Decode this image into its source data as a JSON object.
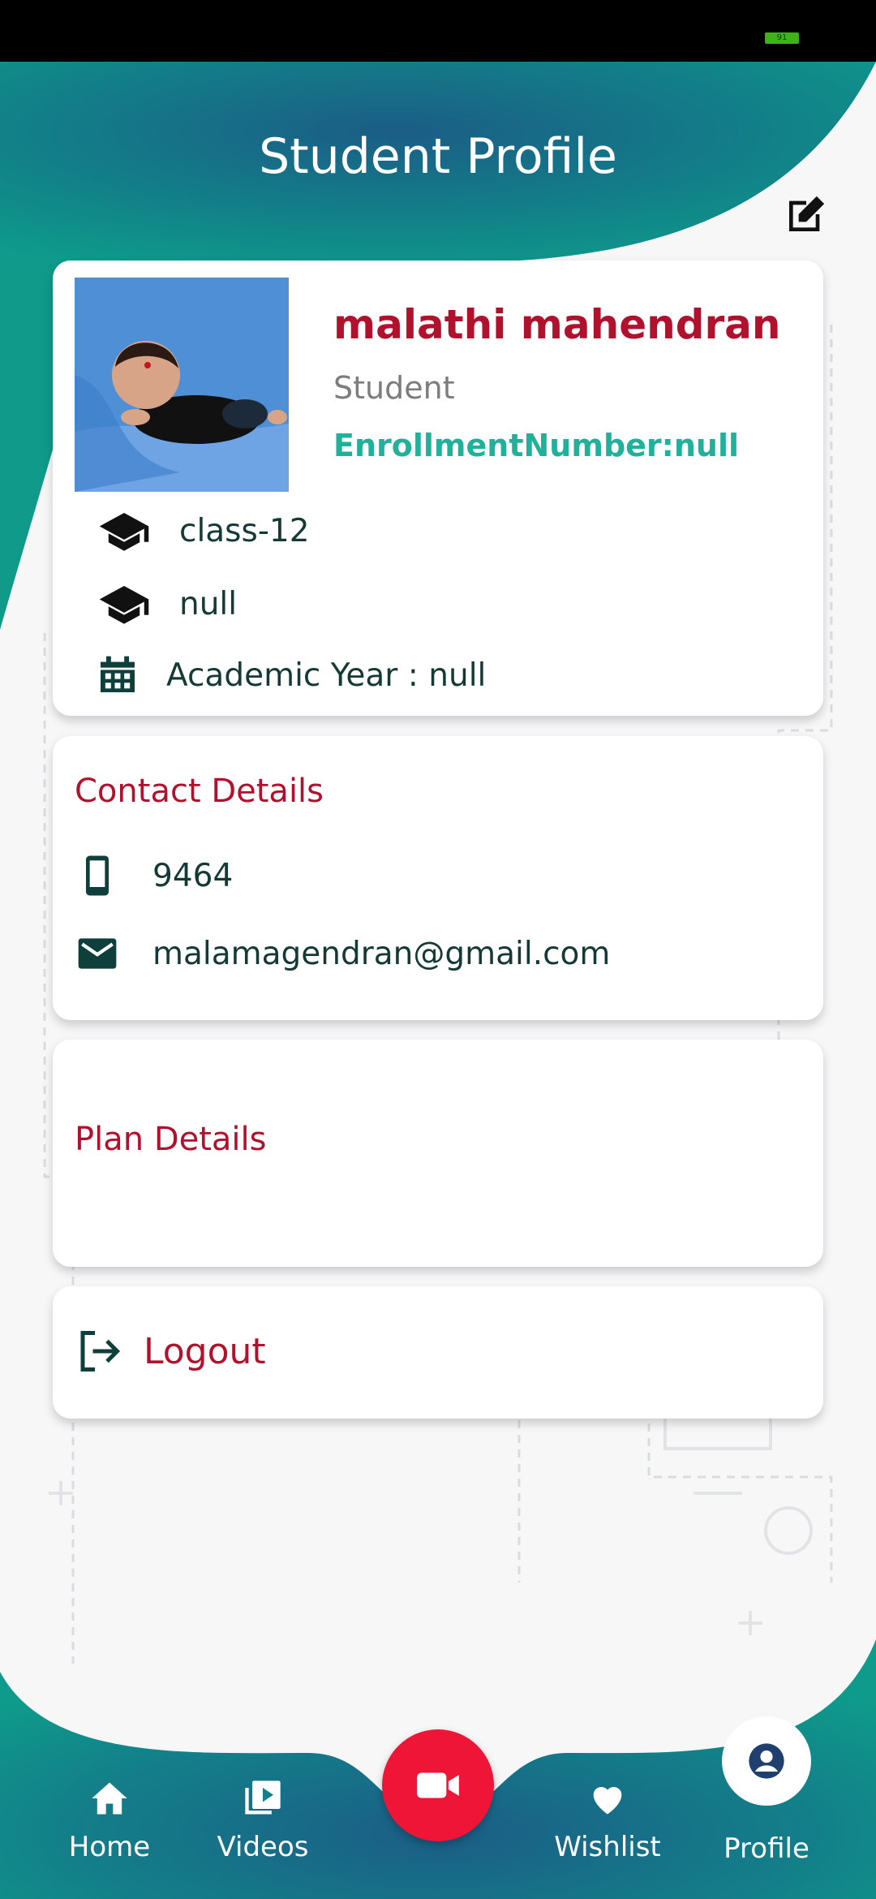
{
  "colors": {
    "primary": "#0f9a8a",
    "accent_red": "#b0112c",
    "teal_text": "#21b09a",
    "fab_red": "#ee1536",
    "dark_text": "#153a36"
  },
  "status_bar": {
    "battery_label": "91"
  },
  "header": {
    "title": "Student Profile",
    "edit_icon": "edit-icon"
  },
  "profile": {
    "name": "malathi mahendran",
    "role": "Student",
    "enrollment": "EnrollmentNumber:null",
    "class_label": "class-12",
    "section_label": "null",
    "academic_year": "Academic Year : null",
    "icons": [
      "graduation-cap-icon",
      "graduation-cap-icon",
      "calendar-icon"
    ]
  },
  "contact": {
    "title": "Contact Details",
    "phone": "9464",
    "email": "malamagendran@gmail.com",
    "icons": [
      "phone-icon",
      "mail-icon"
    ]
  },
  "plan": {
    "title": "Plan Details"
  },
  "logout": {
    "label": "Logout",
    "icon": "logout-icon"
  },
  "bottom_nav": {
    "items": [
      {
        "label": "Home",
        "icon": "home-icon"
      },
      {
        "label": "Videos",
        "icon": "video-library-icon"
      },
      {
        "label": "Wishlist",
        "icon": "heart-icon"
      },
      {
        "label": "Profile",
        "icon": "account-icon",
        "active": true
      }
    ],
    "center_action_icon": "video-camera-icon"
  }
}
